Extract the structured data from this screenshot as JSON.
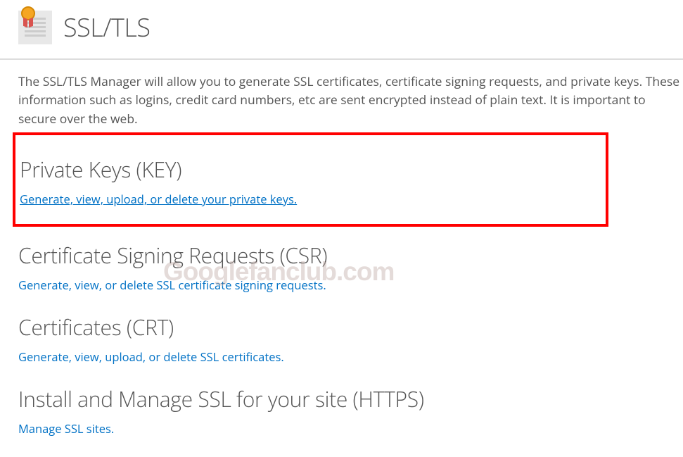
{
  "header": {
    "title": "SSL/TLS"
  },
  "description": "The SSL/TLS Manager will allow you to generate SSL certificates, certificate signing requests, and private keys. These information such as logins, credit card numbers, etc are sent encrypted instead of plain text. It is important to secure over the web.",
  "sections": {
    "key": {
      "title": "Private Keys (KEY)",
      "link": "Generate, view, upload, or delete your private keys."
    },
    "csr": {
      "title": "Certificate Signing Requests (CSR)",
      "link": "Generate, view, or delete SSL certificate signing requests."
    },
    "crt": {
      "title": "Certificates (CRT)",
      "link": "Generate, view, upload, or delete SSL certificates."
    },
    "install": {
      "title": "Install and Manage SSL for your site (HTTPS)",
      "link": "Manage SSL sites."
    }
  },
  "watermark": "Googlefanclub.com"
}
